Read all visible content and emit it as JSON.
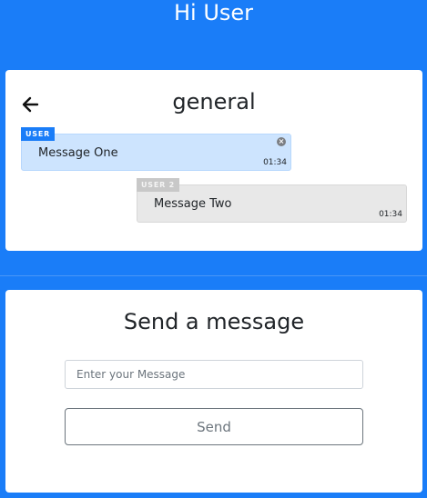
{
  "header": {
    "greeting": "Hi User"
  },
  "chat": {
    "room_name": "general",
    "back_icon": "arrow-left-icon",
    "messages": [
      {
        "author": "USER",
        "text": "Message One",
        "time": "01:34",
        "own": true,
        "delete_icon": "close-circle-icon"
      },
      {
        "author": "USER 2",
        "text": "Message Two",
        "time": "01:34",
        "own": false
      }
    ]
  },
  "composer": {
    "title": "Send a message",
    "placeholder": "Enter your Message",
    "value": "",
    "send_label": "Send"
  },
  "colors": {
    "background": "#1a7df8",
    "own_bubble": "#cde4fe",
    "other_bubble": "#e8e8e8",
    "own_badge": "#1a7df8",
    "other_badge": "#c8c8c8"
  }
}
